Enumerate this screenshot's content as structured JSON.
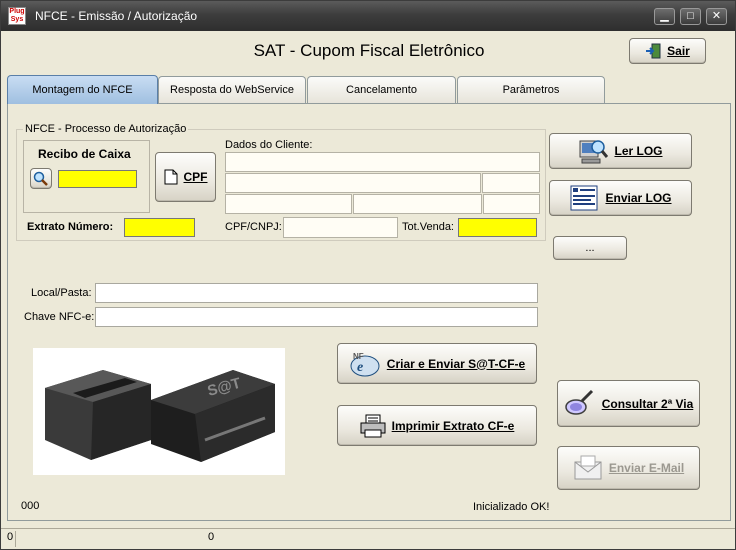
{
  "window": {
    "title": "NFCE - Emissão / Autorização",
    "app_icon_text": "Plug Sys"
  },
  "header": {
    "title": "SAT - Cupom Fiscal Eletrônico",
    "exit_button": "Sair"
  },
  "tabs": [
    {
      "label": "Montagem do NFCE",
      "active": true
    },
    {
      "label": "Resposta do WebService",
      "active": false
    },
    {
      "label": "Cancelamento",
      "active": false
    },
    {
      "label": "Parâmetros",
      "active": false
    }
  ],
  "group": {
    "title": "NFCE - Processo de Autorização"
  },
  "recibo": {
    "label": "Recibo de Caixa",
    "value": ""
  },
  "cpf_button": "CPF",
  "cliente": {
    "label": "Dados do Cliente:"
  },
  "extrato": {
    "label": "Extrato Número:",
    "value": ""
  },
  "cpf_cnpj": {
    "label": "CPF/CNPJ:",
    "value": ""
  },
  "tot_venda": {
    "label": "Tot.Venda:",
    "value": ""
  },
  "local_pasta": {
    "label": "Local/Pasta:",
    "value": ""
  },
  "chave": {
    "label": "Chave NFC-e:",
    "value": ""
  },
  "buttons": {
    "ler_log": "Ler LOG",
    "enviar_log": "Enviar LOG",
    "ellipsis": "...",
    "criar_enviar": "Criar e Enviar S@T-CF-e",
    "imprimir": "Imprimir Extrato CF-e",
    "consultar": "Consultar 2ª Via",
    "enviar_email": "Enviar E-Mail"
  },
  "status": {
    "code": "000",
    "message": "Inicializado OK!"
  },
  "statusbar": {
    "left": "0",
    "middle": "0"
  },
  "colors": {
    "highlight_field": "#ffff00",
    "tab_active": "#9fbfe0"
  }
}
